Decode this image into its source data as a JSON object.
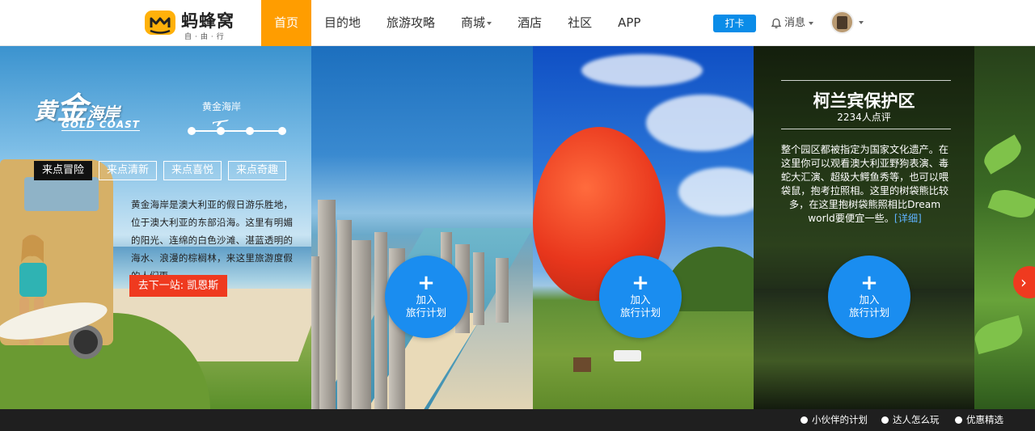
{
  "header": {
    "logo_text": "蚂蜂窝",
    "logo_sub": "自·由·行",
    "nav": [
      {
        "label": "首页",
        "active": true
      },
      {
        "label": "目的地"
      },
      {
        "label": "旅游攻略"
      },
      {
        "label": "商城",
        "dropdown": true
      },
      {
        "label": "酒店"
      },
      {
        "label": "社区"
      },
      {
        "label": "APP"
      }
    ],
    "checkin_label": "打卡",
    "messages_label": "消息",
    "accent_color": "#ff9d00",
    "button_color": "#0a8ce8"
  },
  "intro_panel": {
    "title_part1": "黄",
    "title_part2": "金",
    "title_part3": "海岸",
    "title_en": "GOLD COAST",
    "route_name": "黄金海岸",
    "tags": [
      {
        "label": "来点冒险",
        "active": true
      },
      {
        "label": "来点清新"
      },
      {
        "label": "来点喜悦"
      },
      {
        "label": "来点奇趣"
      }
    ],
    "description": "黄金海岸是澳大利亚的假日游乐胜地，位于澳大利亚的东部沿海。这里有明媚的阳光、连绵的白色沙滩、湛蓝透明的海水、浪漫的棕榈林，来这里旅游度假的人们更",
    "next_stop_label": "去下一站: 凯恩斯"
  },
  "sanctuary_panel": {
    "title": "柯兰宾保护区",
    "reviews": "2234人点评",
    "description": "整个园区都被指定为国家文化遗产。在这里你可以观看澳大利亚野狗表演、毒蛇大汇演、超级大鳄鱼秀等，也可以喂袋鼠，抱考拉照相。这里的树袋熊比较多，在这里抱树袋熊照相比Dream world要便宜一些。",
    "more_label": "[详细]"
  },
  "add_plan": {
    "plus": "+",
    "line1": "加入",
    "line2": "旅行计划"
  },
  "footer": {
    "links": [
      {
        "label": "小伙伴的计划",
        "icon": "plan-icon"
      },
      {
        "label": "达人怎么玩",
        "icon": "expert-icon"
      },
      {
        "label": "优惠精选",
        "icon": "deal-icon"
      }
    ]
  }
}
